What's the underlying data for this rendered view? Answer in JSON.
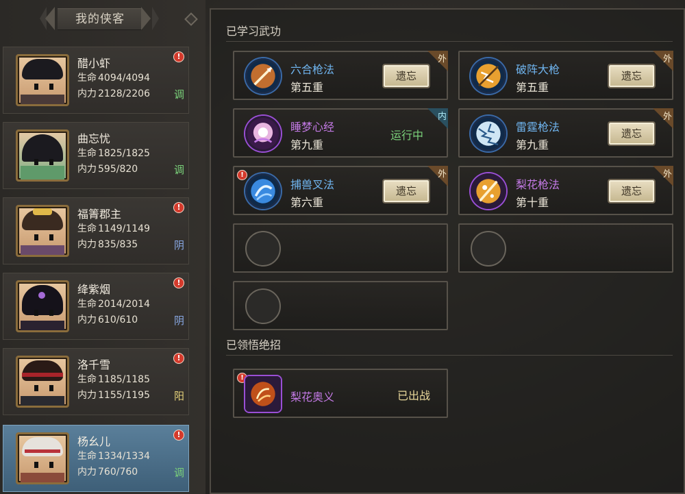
{
  "roster": {
    "title": "我的侠客",
    "heroes": [
      {
        "name": "醋小虾",
        "hp_label": "生命",
        "hp": "4094/4094",
        "mp_label": "内力",
        "mp": "2128/2206",
        "mode": "调",
        "alert": "!",
        "selected": false
      },
      {
        "name": "曲忘忧",
        "hp_label": "生命",
        "hp": "1825/1825",
        "mp_label": "内力",
        "mp": "595/820",
        "mode": "调",
        "alert": "",
        "selected": false
      },
      {
        "name": "福箐郡主",
        "hp_label": "生命",
        "hp": "1149/1149",
        "mp_label": "内力",
        "mp": "835/835",
        "mode": "阴",
        "alert": "!",
        "selected": false
      },
      {
        "name": "绛紫烟",
        "hp_label": "生命",
        "hp": "2014/2014",
        "mp_label": "内力",
        "mp": "610/610",
        "mode": "阴",
        "alert": "!",
        "selected": false
      },
      {
        "name": "洛千雪",
        "hp_label": "生命",
        "hp": "1185/1185",
        "mp_label": "内力",
        "mp": "1155/1195",
        "mode": "阳",
        "alert": "!",
        "selected": false
      },
      {
        "name": "杨幺儿",
        "hp_label": "生命",
        "hp": "1334/1334",
        "mp_label": "内力",
        "mp": "760/760",
        "mode": "调",
        "alert": "!",
        "selected": true
      }
    ]
  },
  "learned": {
    "title": "已学习武功",
    "skills": [
      {
        "name": "六合枪法",
        "level": "第五重",
        "action": "遗忘",
        "tag": "外",
        "color": "blue",
        "icon": "spear-thrust-icon",
        "alert": ""
      },
      {
        "name": "破阵大枪",
        "level": "第五重",
        "action": "遗忘",
        "tag": "外",
        "color": "blue",
        "icon": "spear-lightning-icon",
        "alert": ""
      },
      {
        "name": "睡梦心经",
        "level": "第九重",
        "status": "运行中",
        "tag": "内",
        "color": "purple",
        "icon": "dream-sutra-icon",
        "alert": ""
      },
      {
        "name": "雷霆枪法",
        "level": "第九重",
        "action": "遗忘",
        "tag": "外",
        "color": "blue",
        "icon": "thunder-spear-icon",
        "alert": ""
      },
      {
        "name": "捕兽叉法",
        "level": "第六重",
        "action": "遗忘",
        "tag": "外",
        "color": "blue",
        "icon": "beast-fork-icon",
        "alert": "!"
      },
      {
        "name": "梨花枪法",
        "level": "第十重",
        "action": "遗忘",
        "tag": "外",
        "color": "purple",
        "icon": "pear-blossom-spear-icon",
        "alert": ""
      }
    ]
  },
  "ultimate": {
    "title": "已领悟绝招",
    "skills": [
      {
        "name": "梨花奥义",
        "status": "已出战",
        "color": "purple",
        "icon": "pear-blossom-ultimate-icon",
        "alert": "!"
      }
    ]
  },
  "colors": {
    "blue_skill": "#6fb4ee",
    "purple_skill": "#c47ae6",
    "running": "#7ad07a",
    "deployed": "#e8d79a",
    "alert": "#d43a2c",
    "selected_row": "#5a7f9a"
  }
}
